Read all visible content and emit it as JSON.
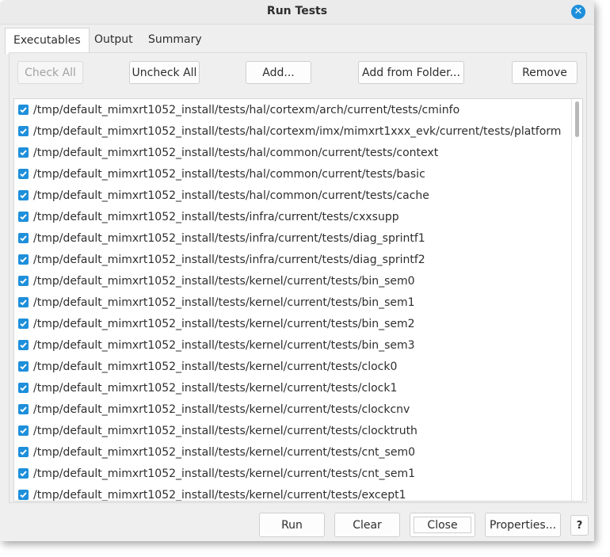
{
  "window": {
    "title": "Run Tests",
    "close_icon": "close-circle-icon",
    "close_glyph": "✕"
  },
  "tabs": [
    {
      "label": "Executables",
      "active": true
    },
    {
      "label": "Output",
      "active": false
    },
    {
      "label": "Summary",
      "active": false
    }
  ],
  "toolbar": {
    "check_all": {
      "label": "Check All",
      "enabled": false
    },
    "uncheck_all": {
      "label": "Uncheck All",
      "enabled": true
    },
    "add": {
      "label": "Add...",
      "enabled": true
    },
    "add_from_folder": {
      "label": "Add from Folder...",
      "enabled": true
    },
    "remove": {
      "label": "Remove",
      "enabled": true
    }
  },
  "executables": [
    {
      "path": "/tmp/default_mimxrt1052_install/tests/hal/cortexm/arch/current/tests/cminfo",
      "checked": true
    },
    {
      "path": "/tmp/default_mimxrt1052_install/tests/hal/cortexm/imx/mimxrt1xxx_evk/current/tests/platform",
      "checked": true
    },
    {
      "path": "/tmp/default_mimxrt1052_install/tests/hal/common/current/tests/context",
      "checked": true
    },
    {
      "path": "/tmp/default_mimxrt1052_install/tests/hal/common/current/tests/basic",
      "checked": true
    },
    {
      "path": "/tmp/default_mimxrt1052_install/tests/hal/common/current/tests/cache",
      "checked": true
    },
    {
      "path": "/tmp/default_mimxrt1052_install/tests/infra/current/tests/cxxsupp",
      "checked": true
    },
    {
      "path": "/tmp/default_mimxrt1052_install/tests/infra/current/tests/diag_sprintf1",
      "checked": true
    },
    {
      "path": "/tmp/default_mimxrt1052_install/tests/infra/current/tests/diag_sprintf2",
      "checked": true
    },
    {
      "path": "/tmp/default_mimxrt1052_install/tests/kernel/current/tests/bin_sem0",
      "checked": true
    },
    {
      "path": "/tmp/default_mimxrt1052_install/tests/kernel/current/tests/bin_sem1",
      "checked": true
    },
    {
      "path": "/tmp/default_mimxrt1052_install/tests/kernel/current/tests/bin_sem2",
      "checked": true
    },
    {
      "path": "/tmp/default_mimxrt1052_install/tests/kernel/current/tests/bin_sem3",
      "checked": true
    },
    {
      "path": "/tmp/default_mimxrt1052_install/tests/kernel/current/tests/clock0",
      "checked": true
    },
    {
      "path": "/tmp/default_mimxrt1052_install/tests/kernel/current/tests/clock1",
      "checked": true
    },
    {
      "path": "/tmp/default_mimxrt1052_install/tests/kernel/current/tests/clockcnv",
      "checked": true
    },
    {
      "path": "/tmp/default_mimxrt1052_install/tests/kernel/current/tests/clocktruth",
      "checked": true
    },
    {
      "path": "/tmp/default_mimxrt1052_install/tests/kernel/current/tests/cnt_sem0",
      "checked": true
    },
    {
      "path": "/tmp/default_mimxrt1052_install/tests/kernel/current/tests/cnt_sem1",
      "checked": true
    },
    {
      "path": "/tmp/default_mimxrt1052_install/tests/kernel/current/tests/except1",
      "checked": true
    }
  ],
  "footer": {
    "run": "Run",
    "clear": "Clear",
    "close": "Close",
    "properties": "Properties...",
    "help": "?"
  },
  "colors": {
    "accent": "#1e8fdb",
    "window_bg": "#efefef",
    "list_bg": "#ffffff",
    "disabled_text": "#a3a3a3"
  }
}
